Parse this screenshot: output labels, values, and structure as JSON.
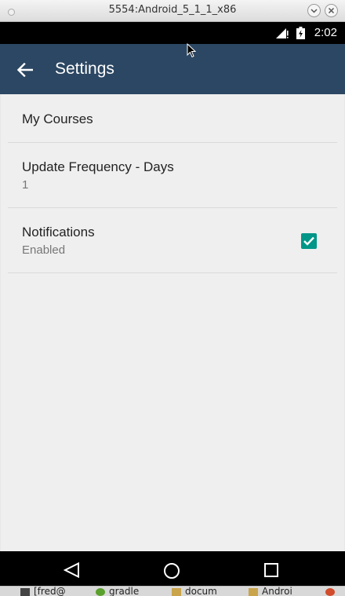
{
  "window": {
    "title": "5554:Android_5_1_1_x86"
  },
  "status_bar": {
    "time": "2:02"
  },
  "app_bar": {
    "title": "Settings"
  },
  "preferences": [
    {
      "title": "My Courses",
      "summary": ""
    },
    {
      "title": "Update Frequency - Days",
      "summary": "1"
    },
    {
      "title": "Notifications",
      "summary": "Enabled",
      "checked": true
    }
  ],
  "taskbar": {
    "items": [
      "[fred@",
      "gradle",
      "docum",
      "Androi"
    ]
  },
  "colors": {
    "app_bar": "#2c4763",
    "accent": "#009688",
    "background": "#efefef"
  }
}
